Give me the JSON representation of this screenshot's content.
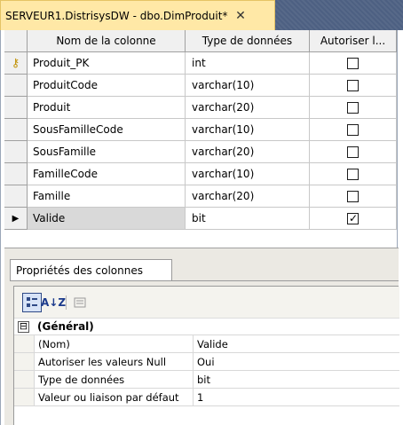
{
  "tab": {
    "title": "SERVEUR1.DistrisysDW - dbo.DimProduit*",
    "close": "✕"
  },
  "grid": {
    "headers": {
      "name": "Nom de la colonne",
      "type": "Type de données",
      "null": "Autoriser l..."
    },
    "rows": [
      {
        "name": "Produit_PK",
        "type": "int",
        "allow_null": false
      },
      {
        "name": "ProduitCode",
        "type": "varchar(10)",
        "allow_null": false
      },
      {
        "name": "Produit",
        "type": "varchar(20)",
        "allow_null": false
      },
      {
        "name": "SousFamilleCode",
        "type": "varchar(10)",
        "allow_null": false
      },
      {
        "name": "SousFamille",
        "type": "varchar(20)",
        "allow_null": false
      },
      {
        "name": "FamilleCode",
        "type": "varchar(10)",
        "allow_null": false
      },
      {
        "name": "Famille",
        "type": "varchar(20)",
        "allow_null": false
      },
      {
        "name": "Valide",
        "type": "bit",
        "allow_null": true
      }
    ],
    "primary_key_icon": "key-icon",
    "current_row_icon": "row-arrow-icon"
  },
  "properties": {
    "tab_label": "Propriétés des colonnes",
    "toolbar": {
      "sort_label": "A↓Z"
    },
    "category": {
      "expander": "⊟",
      "label": "(Général)"
    },
    "rows": [
      {
        "name": "(Nom)",
        "value": "Valide"
      },
      {
        "name": "Autoriser les valeurs Null",
        "value": "Oui"
      },
      {
        "name": "Type de données",
        "value": "bit"
      },
      {
        "name": "Valeur ou liaison par défaut",
        "value": "1"
      }
    ]
  }
}
